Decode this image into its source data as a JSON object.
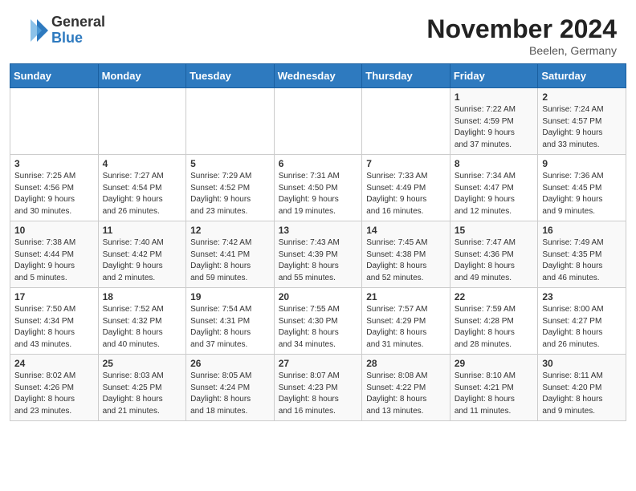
{
  "header": {
    "logo_general": "General",
    "logo_blue": "Blue",
    "title": "November 2024",
    "location": "Beelen, Germany"
  },
  "weekdays": [
    "Sunday",
    "Monday",
    "Tuesday",
    "Wednesday",
    "Thursday",
    "Friday",
    "Saturday"
  ],
  "weeks": [
    [
      {
        "day": "",
        "info": ""
      },
      {
        "day": "",
        "info": ""
      },
      {
        "day": "",
        "info": ""
      },
      {
        "day": "",
        "info": ""
      },
      {
        "day": "",
        "info": ""
      },
      {
        "day": "1",
        "info": "Sunrise: 7:22 AM\nSunset: 4:59 PM\nDaylight: 9 hours\nand 37 minutes."
      },
      {
        "day": "2",
        "info": "Sunrise: 7:24 AM\nSunset: 4:57 PM\nDaylight: 9 hours\nand 33 minutes."
      }
    ],
    [
      {
        "day": "3",
        "info": "Sunrise: 7:25 AM\nSunset: 4:56 PM\nDaylight: 9 hours\nand 30 minutes."
      },
      {
        "day": "4",
        "info": "Sunrise: 7:27 AM\nSunset: 4:54 PM\nDaylight: 9 hours\nand 26 minutes."
      },
      {
        "day": "5",
        "info": "Sunrise: 7:29 AM\nSunset: 4:52 PM\nDaylight: 9 hours\nand 23 minutes."
      },
      {
        "day": "6",
        "info": "Sunrise: 7:31 AM\nSunset: 4:50 PM\nDaylight: 9 hours\nand 19 minutes."
      },
      {
        "day": "7",
        "info": "Sunrise: 7:33 AM\nSunset: 4:49 PM\nDaylight: 9 hours\nand 16 minutes."
      },
      {
        "day": "8",
        "info": "Sunrise: 7:34 AM\nSunset: 4:47 PM\nDaylight: 9 hours\nand 12 minutes."
      },
      {
        "day": "9",
        "info": "Sunrise: 7:36 AM\nSunset: 4:45 PM\nDaylight: 9 hours\nand 9 minutes."
      }
    ],
    [
      {
        "day": "10",
        "info": "Sunrise: 7:38 AM\nSunset: 4:44 PM\nDaylight: 9 hours\nand 5 minutes."
      },
      {
        "day": "11",
        "info": "Sunrise: 7:40 AM\nSunset: 4:42 PM\nDaylight: 9 hours\nand 2 minutes."
      },
      {
        "day": "12",
        "info": "Sunrise: 7:42 AM\nSunset: 4:41 PM\nDaylight: 8 hours\nand 59 minutes."
      },
      {
        "day": "13",
        "info": "Sunrise: 7:43 AM\nSunset: 4:39 PM\nDaylight: 8 hours\nand 55 minutes."
      },
      {
        "day": "14",
        "info": "Sunrise: 7:45 AM\nSunset: 4:38 PM\nDaylight: 8 hours\nand 52 minutes."
      },
      {
        "day": "15",
        "info": "Sunrise: 7:47 AM\nSunset: 4:36 PM\nDaylight: 8 hours\nand 49 minutes."
      },
      {
        "day": "16",
        "info": "Sunrise: 7:49 AM\nSunset: 4:35 PM\nDaylight: 8 hours\nand 46 minutes."
      }
    ],
    [
      {
        "day": "17",
        "info": "Sunrise: 7:50 AM\nSunset: 4:34 PM\nDaylight: 8 hours\nand 43 minutes."
      },
      {
        "day": "18",
        "info": "Sunrise: 7:52 AM\nSunset: 4:32 PM\nDaylight: 8 hours\nand 40 minutes."
      },
      {
        "day": "19",
        "info": "Sunrise: 7:54 AM\nSunset: 4:31 PM\nDaylight: 8 hours\nand 37 minutes."
      },
      {
        "day": "20",
        "info": "Sunrise: 7:55 AM\nSunset: 4:30 PM\nDaylight: 8 hours\nand 34 minutes."
      },
      {
        "day": "21",
        "info": "Sunrise: 7:57 AM\nSunset: 4:29 PM\nDaylight: 8 hours\nand 31 minutes."
      },
      {
        "day": "22",
        "info": "Sunrise: 7:59 AM\nSunset: 4:28 PM\nDaylight: 8 hours\nand 28 minutes."
      },
      {
        "day": "23",
        "info": "Sunrise: 8:00 AM\nSunset: 4:27 PM\nDaylight: 8 hours\nand 26 minutes."
      }
    ],
    [
      {
        "day": "24",
        "info": "Sunrise: 8:02 AM\nSunset: 4:26 PM\nDaylight: 8 hours\nand 23 minutes."
      },
      {
        "day": "25",
        "info": "Sunrise: 8:03 AM\nSunset: 4:25 PM\nDaylight: 8 hours\nand 21 minutes."
      },
      {
        "day": "26",
        "info": "Sunrise: 8:05 AM\nSunset: 4:24 PM\nDaylight: 8 hours\nand 18 minutes."
      },
      {
        "day": "27",
        "info": "Sunrise: 8:07 AM\nSunset: 4:23 PM\nDaylight: 8 hours\nand 16 minutes."
      },
      {
        "day": "28",
        "info": "Sunrise: 8:08 AM\nSunset: 4:22 PM\nDaylight: 8 hours\nand 13 minutes."
      },
      {
        "day": "29",
        "info": "Sunrise: 8:10 AM\nSunset: 4:21 PM\nDaylight: 8 hours\nand 11 minutes."
      },
      {
        "day": "30",
        "info": "Sunrise: 8:11 AM\nSunset: 4:20 PM\nDaylight: 8 hours\nand 9 minutes."
      }
    ]
  ]
}
